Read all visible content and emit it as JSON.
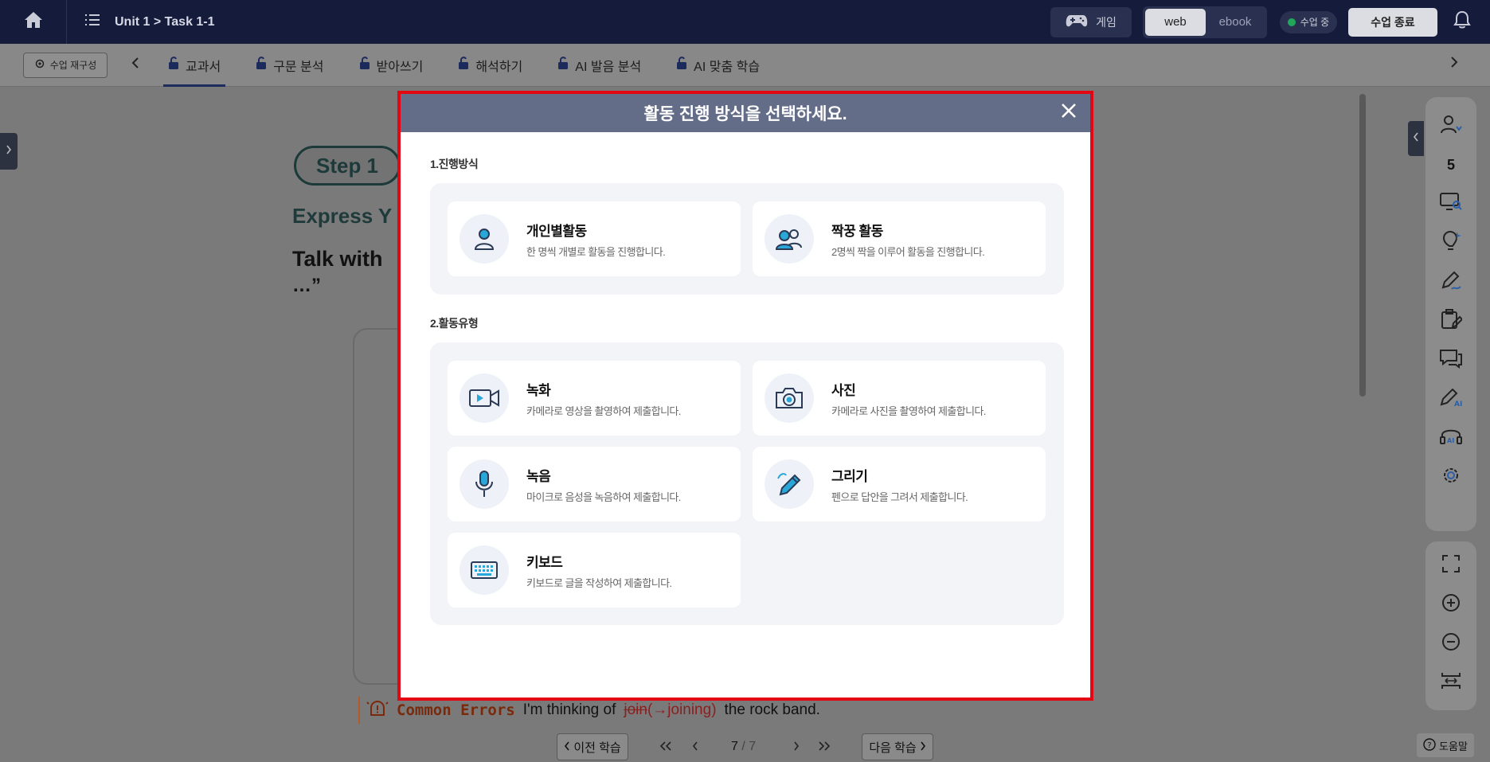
{
  "topbar": {
    "breadcrumb": "Unit 1 > Task 1-1",
    "game_label": "게임",
    "web_label": "web",
    "ebook_label": "ebook",
    "live_label": "수업 중",
    "end_label": "수업 종료"
  },
  "tabbar": {
    "rebuild_label": "수업 재구성",
    "tabs": [
      "교과서",
      "구문 분석",
      "받아쓰기",
      "해석하기",
      "AI 발음 분석",
      "AI 맞춤 학습"
    ],
    "active_tab": "교과서"
  },
  "background": {
    "step_label": "Step 1",
    "heading": "Express Y",
    "talk": "Talk with",
    "dots": "…”",
    "common_errors_label": "Common Errors",
    "sentence_start": "I'm thinking of",
    "struck_word": "join",
    "correction": "(→joining)",
    "sentence_end": "the rock band."
  },
  "bottom_nav": {
    "prev_label": "이전 학습",
    "next_label": "다음 학습",
    "current_page": "7",
    "total_pages": "/ 7",
    "help_label": "도움말"
  },
  "rail": {
    "count": "5"
  },
  "modal": {
    "title": "활동 진행 방식을 선택하세요.",
    "section1_title": "1.진행방식",
    "section2_title": "2.활동유형",
    "modes": [
      {
        "icon": "person-icon",
        "title": "개인별활동",
        "desc": "한 명씩 개별로 활동을 진행합니다."
      },
      {
        "icon": "pair-icon",
        "title": "짝꿍 활동",
        "desc": "2명씩 짝을 이루어 활동을 진행합니다."
      }
    ],
    "types": [
      {
        "icon": "video-icon",
        "title": "녹화",
        "desc": "카메라로 영상을 촬영하여 제출합니다."
      },
      {
        "icon": "camera-icon",
        "title": "사진",
        "desc": "카메라로 사진을 촬영하여 제출합니다."
      },
      {
        "icon": "microphone-icon",
        "title": "녹음",
        "desc": "마이크로 음성을 녹음하여 제출합니다."
      },
      {
        "icon": "pencil-icon",
        "title": "그리기",
        "desc": "펜으로 답안을 그려서 제출합니다."
      },
      {
        "icon": "keyboard-icon",
        "title": "키보드",
        "desc": "키보드로 글을 작성하여 제출합니다."
      }
    ]
  },
  "colors": {
    "modal_border": "#e30613",
    "modal_header": "#646d88",
    "topbar": "#151b3b",
    "icon_accent": "#2aa7d9",
    "icon_dark": "#2b3a55"
  }
}
